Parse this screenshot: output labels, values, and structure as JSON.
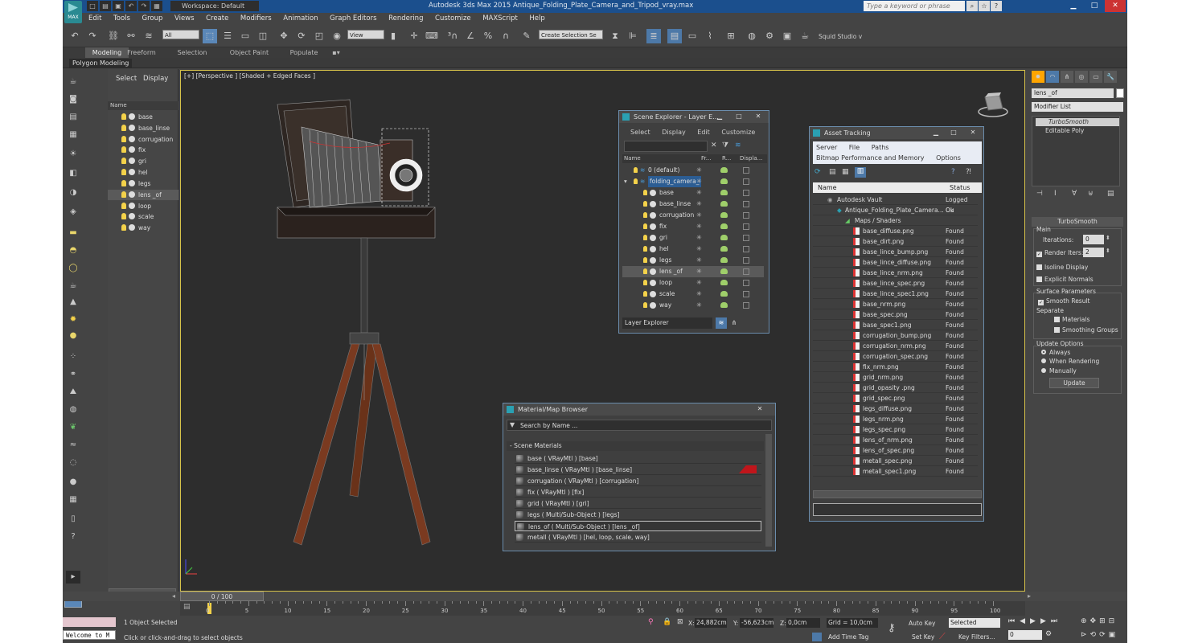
{
  "window": {
    "title": "Autodesk 3ds Max  2015     Antique_Folding_Plate_Camera_and_Tripod_vray.max",
    "workspace": "Workspace: Default",
    "search_placeholder": "Type a keyword or phrase",
    "app_logo": "MAX"
  },
  "menu": [
    "Edit",
    "Tools",
    "Group",
    "Views",
    "Create",
    "Modifiers",
    "Animation",
    "Graph Editors",
    "Rendering",
    "Customize",
    "MAXScript",
    "Help"
  ],
  "toolbar": {
    "filter": "All",
    "ref_coord": "View",
    "selection_set": "Create Selection Se",
    "studio": "Squid Studio v"
  },
  "ribbon": {
    "tabs": [
      "Modeling",
      "Freeform",
      "Selection",
      "Object Paint",
      "Populate"
    ],
    "subtab": "Polygon Modeling"
  },
  "scene_panel": {
    "tabs": [
      "Select",
      "Display"
    ],
    "column": "Name",
    "items": [
      "base",
      "base_linse",
      "corrugation",
      "fix",
      "gri",
      "hel",
      "legs",
      "lens _of",
      "loop",
      "scale",
      "way"
    ],
    "selected": "lens _of"
  },
  "viewport": {
    "label": "[+] [Perspective ] [Shaded + Edged Faces ]"
  },
  "layer_explorer": {
    "title": "Scene Explorer - Layer E...",
    "menu": [
      "Select",
      "Display",
      "Edit",
      "Customize"
    ],
    "columns": [
      "Name",
      "Fr...",
      "R...",
      "Displa..."
    ],
    "default_layer": "0 (default)",
    "layer": "folding_camera_",
    "items": [
      "base",
      "base_linse",
      "corrugation",
      "fix",
      "gri",
      "hel",
      "legs",
      "lens _of",
      "loop",
      "scale",
      "way"
    ],
    "footer": "Layer Explorer"
  },
  "asset_tracking": {
    "title": "Asset Tracking",
    "menu1": [
      "Server",
      "File",
      "Paths"
    ],
    "menu2": [
      "Bitmap Performance and Memory",
      "Options"
    ],
    "columns": [
      "Name",
      "Status"
    ],
    "vault": {
      "name": "Autodesk Vault",
      "status": "Logged Ou"
    },
    "file": {
      "name": "Antique_Folding_Plate_Camera...",
      "status": "Ok"
    },
    "group": "Maps / Shaders",
    "maps": [
      {
        "name": "base_diffuse.png",
        "status": "Found"
      },
      {
        "name": "base_dirt.png",
        "status": "Found"
      },
      {
        "name": "base_lince_bump.png",
        "status": "Found"
      },
      {
        "name": "base_lince_diffuse.png",
        "status": "Found"
      },
      {
        "name": "base_lince_nrm.png",
        "status": "Found"
      },
      {
        "name": "base_lince_spec.png",
        "status": "Found"
      },
      {
        "name": "base_lince_spec1.png",
        "status": "Found"
      },
      {
        "name": "base_nrm.png",
        "status": "Found"
      },
      {
        "name": "base_spec.png",
        "status": "Found"
      },
      {
        "name": "base_spec1.png",
        "status": "Found"
      },
      {
        "name": "corrugation_bump.png",
        "status": "Found"
      },
      {
        "name": "corrugation_nrm.png",
        "status": "Found"
      },
      {
        "name": "corrugation_spec.png",
        "status": "Found"
      },
      {
        "name": "fix_nrm.png",
        "status": "Found"
      },
      {
        "name": "grid_nrm.png",
        "status": "Found"
      },
      {
        "name": "grid_opasity .png",
        "status": "Found"
      },
      {
        "name": "grid_spec.png",
        "status": "Found"
      },
      {
        "name": "legs_diffuse.png",
        "status": "Found"
      },
      {
        "name": "legs_nrm.png",
        "status": "Found"
      },
      {
        "name": "legs_spec.png",
        "status": "Found"
      },
      {
        "name": "lens_of_nrm.png",
        "status": "Found"
      },
      {
        "name": "lens_of_spec.png",
        "status": "Found"
      },
      {
        "name": "metall_spec.png",
        "status": "Found"
      },
      {
        "name": "metall_spec1.png",
        "status": "Found"
      }
    ]
  },
  "material_browser": {
    "title": "Material/Map Browser",
    "search": "Search by Name ...",
    "group": "- Scene Materials",
    "items": [
      "base  ( VRayMtl ) [base]",
      "base_linse  ( VRayMtl ) [base_linse]",
      "corrugation  ( VRayMtl ) [corrugation]",
      "fix  ( VRayMtl ) [fix]",
      "grid  ( VRayMtl ) [gri]",
      "legs  ( Multi/Sub-Object ) [legs]",
      "lens_of  ( Multi/Sub-Object ) [lens _of]",
      "metall  ( VRayMtl ) [hel, loop, scale, way]"
    ]
  },
  "command_panel": {
    "object_name": "lens _of",
    "modifier_list": "Modifier List",
    "stack": [
      "TurboSmooth",
      "Editable Poly"
    ],
    "rollout": "TurboSmooth",
    "main": "Main",
    "iterations_label": "Iterations:",
    "iterations": "0",
    "render_iters_label": "Render Iters:",
    "render_iters": "2",
    "isoline": "Isoline Display",
    "explicit": "Explicit Normals",
    "surface": "Surface Parameters",
    "smooth_result": "Smooth Result",
    "separate": "Separate",
    "materials": "Materials",
    "smoothing_groups": "Smoothing Groups",
    "update_options": "Update Options",
    "always": "Always",
    "when_rendering": "When Rendering",
    "manually": "Manually",
    "update_button": "Update"
  },
  "timeline": {
    "range": "0 / 100",
    "ticks": [
      "0",
      "5",
      "10",
      "15",
      "20",
      "25",
      "30",
      "35",
      "40",
      "45",
      "50",
      "55",
      "60",
      "65",
      "70",
      "75",
      "80",
      "85",
      "90",
      "95",
      "100"
    ]
  },
  "status": {
    "listener": "Welcome to M",
    "selected": "1 Object Selected",
    "prompt": "Click or click-and-drag to select objects",
    "x_label": "X:",
    "x": "24,882cm",
    "y_label": "Y:",
    "y": "-56,623cm",
    "z_label": "Z:",
    "z": "0,0cm",
    "grid": "Grid = 10,0cm",
    "add_time_tag": "Add Time Tag",
    "auto_key": "Auto Key",
    "set_key": "Set Key",
    "key_mode": "Selected",
    "frame": "0",
    "key_filters": "Key Filters..."
  }
}
